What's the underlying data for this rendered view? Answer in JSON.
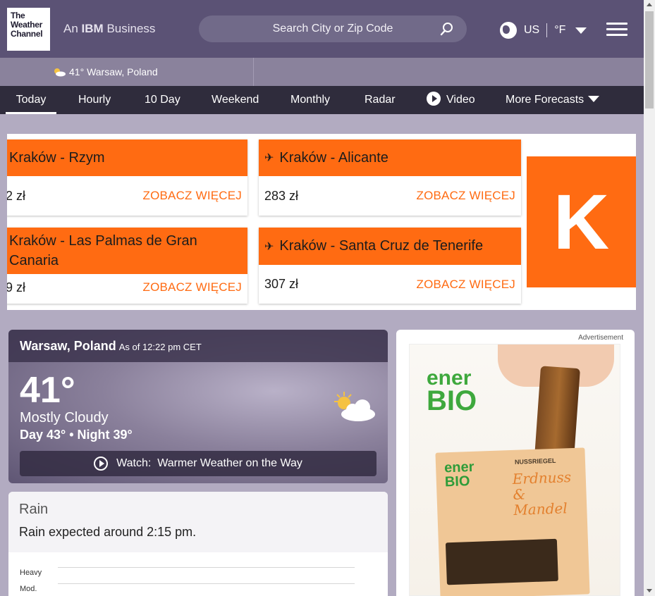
{
  "header": {
    "logo_lines": [
      "The",
      "Weather",
      "Channel"
    ],
    "ibm_prefix": "An",
    "ibm_brand": "IBM",
    "ibm_suffix": "Business",
    "search_placeholder": "Search City or Zip Code",
    "region": "US",
    "unit": "°F"
  },
  "recent": {
    "temp": "41°",
    "location": "Warsaw, Poland"
  },
  "nav": {
    "items": [
      "Today",
      "Hourly",
      "10 Day",
      "Weekend",
      "Monthly",
      "Radar",
      "Video",
      "More Forecasts"
    ]
  },
  "ad_banner": {
    "deals": [
      {
        "route": "Kraków - Rzym",
        "price": "2 zł",
        "cta": "ZOBACZ WIĘCEJ"
      },
      {
        "route": "Kraków - Alicante",
        "price": "283 zł",
        "cta": "ZOBACZ WIĘCEJ"
      },
      {
        "route": "Kraków - Las Palmas de Gran Canaria",
        "price": "9 zł",
        "cta": "ZOBACZ WIĘCEJ"
      },
      {
        "route": "Kraków - Santa Cruz de Tenerife",
        "price": "307 zł",
        "cta": "ZOBACZ WIĘCEJ"
      }
    ],
    "brand_letter": "K"
  },
  "current": {
    "location": "Warsaw, Poland",
    "as_of": "As of 12:22 pm CET",
    "temp": "41°",
    "phrase": "Mostly Cloudy",
    "hilo": "Day 43° • Night 39°",
    "watch_label": "Watch:",
    "watch_title": "Warmer Weather on the Way"
  },
  "rain": {
    "title": "Rain",
    "message": "Rain expected around 2:15 pm.",
    "levels": [
      "Heavy",
      "Mod."
    ]
  },
  "side_ad": {
    "label": "Advertisement",
    "brand_line1": "ener",
    "brand_line2": "BIO",
    "product_type": "NUSSRIEGEL",
    "product_name": "Erdnuss & Mandel"
  },
  "colors": {
    "header": "#5b5275",
    "nav": "#2f2c3c",
    "kayak_orange": "#ff6b12"
  }
}
